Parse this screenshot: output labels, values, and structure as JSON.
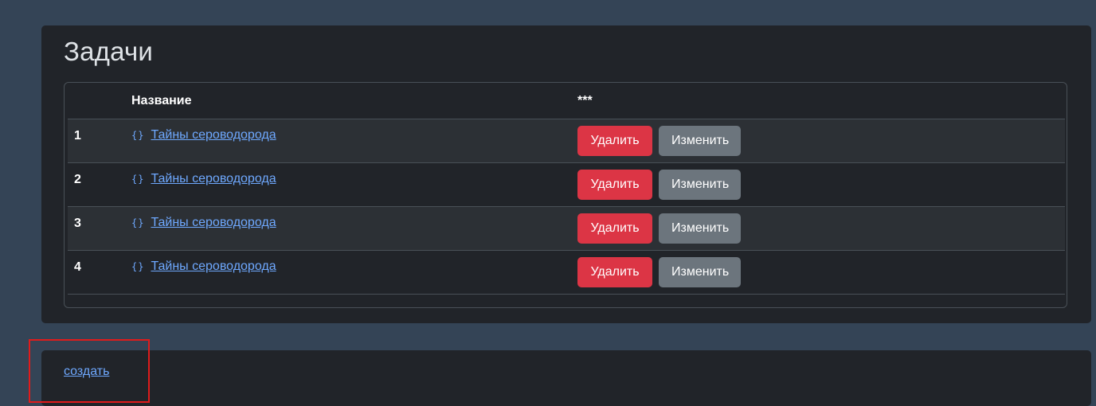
{
  "page": {
    "title": "Задачи"
  },
  "table": {
    "headers": {
      "number": "",
      "name": "Название",
      "actions": "***"
    },
    "rows": [
      {
        "number": "1",
        "icon": "{}",
        "name": "Тайны сероводорода",
        "delete_label": "Удалить",
        "edit_label": "Изменить"
      },
      {
        "number": "2",
        "icon": "{}",
        "name": "Тайны сероводорода",
        "delete_label": "Удалить",
        "edit_label": "Изменить"
      },
      {
        "number": "3",
        "icon": "{}",
        "name": "Тайны сероводорода",
        "delete_label": "Удалить",
        "edit_label": "Изменить"
      },
      {
        "number": "4",
        "icon": "{}",
        "name": "Тайны сероводорода",
        "delete_label": "Удалить",
        "edit_label": "Изменить"
      }
    ]
  },
  "footer": {
    "create_label": "создать"
  },
  "colors": {
    "background": "#344456",
    "card": "#212429",
    "danger": "#dc3545",
    "secondary": "#6c757d",
    "link": "#6ea8fe",
    "highlight": "#e01b1b"
  }
}
